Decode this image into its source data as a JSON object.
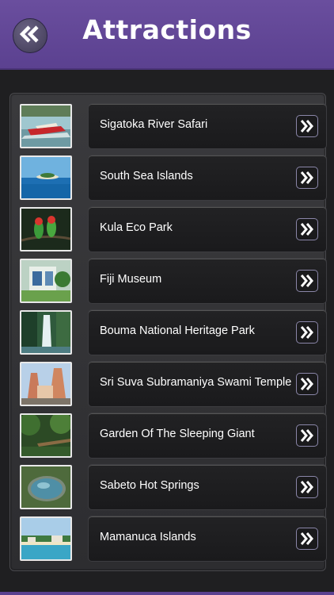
{
  "header": {
    "title": "Attractions",
    "back_icon": "double-chevron-left-icon",
    "accent_color": "#5b4190"
  },
  "attractions": [
    {
      "label": "Sigatoka River Safari",
      "thumb": "jet-boat"
    },
    {
      "label": "South Sea Islands",
      "thumb": "island"
    },
    {
      "label": "Kula Eco Park",
      "thumb": "parrots"
    },
    {
      "label": "Fiji Museum",
      "thumb": "museum"
    },
    {
      "label": "Bouma National Heritage Park",
      "thumb": "waterfall"
    },
    {
      "label": "Sri Suva Subramaniya Swami Temple",
      "thumb": "temple"
    },
    {
      "label": "Garden Of The Sleeping Giant",
      "thumb": "garden"
    },
    {
      "label": "Sabeto Hot Springs",
      "thumb": "hot-spring"
    },
    {
      "label": "Mamanuca Islands",
      "thumb": "resort-beach"
    }
  ],
  "row_arrow_icon": "double-chevron-right-icon"
}
